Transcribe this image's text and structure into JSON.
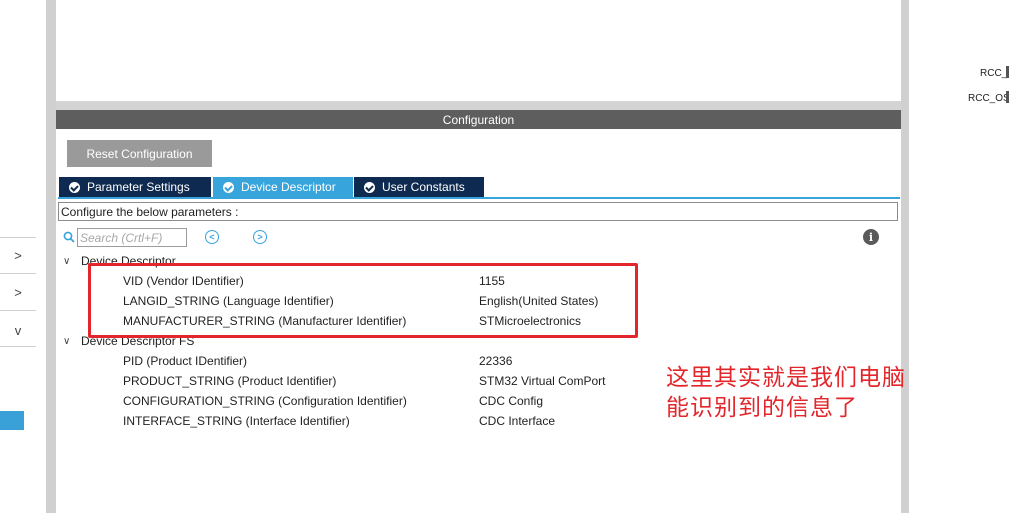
{
  "left_strip": {
    "chevrons": [
      ">",
      ">",
      "v"
    ]
  },
  "configuration": {
    "header": "Configuration",
    "reset_label": "Reset Configuration",
    "tabs": [
      {
        "label": "Parameter Settings",
        "active": false
      },
      {
        "label": "Device Descriptor",
        "active": true
      },
      {
        "label": "User Constants",
        "active": false
      }
    ],
    "configure_text": "Configure the below parameters :",
    "search_placeholder": "Search (Crtl+F)"
  },
  "groups": [
    {
      "title": "Device Descriptor",
      "params": [
        {
          "name": "VID (Vendor IDentifier)",
          "value": "1155"
        },
        {
          "name": "LANGID_STRING (Language Identifier)",
          "value": "English(United States)"
        },
        {
          "name": "MANUFACTURER_STRING (Manufacturer Identifier)",
          "value": "STMicroelectronics"
        }
      ]
    },
    {
      "title": "Device Descriptor FS",
      "params": [
        {
          "name": "PID (Product IDentifier)",
          "value": "22336"
        },
        {
          "name": "PRODUCT_STRING (Product Identifier)",
          "value": "STM32 Virtual ComPort"
        },
        {
          "name": "CONFIGURATION_STRING (Configuration Identifier)",
          "value": "CDC Config"
        },
        {
          "name": "INTERFACE_STRING (Interface Identifier)",
          "value": "CDC Interface"
        }
      ]
    }
  ],
  "annotation": {
    "line1": "这里其实就是我们电脑",
    "line2": "能识别到的信息了"
  },
  "pins": [
    "RCC_C",
    "RCC_OS"
  ],
  "colors": {
    "tab_dark": "#0e2a50",
    "tab_active": "#37a4dc",
    "annotation_red": "#e3262b",
    "header_grey": "#5e5e5e"
  }
}
